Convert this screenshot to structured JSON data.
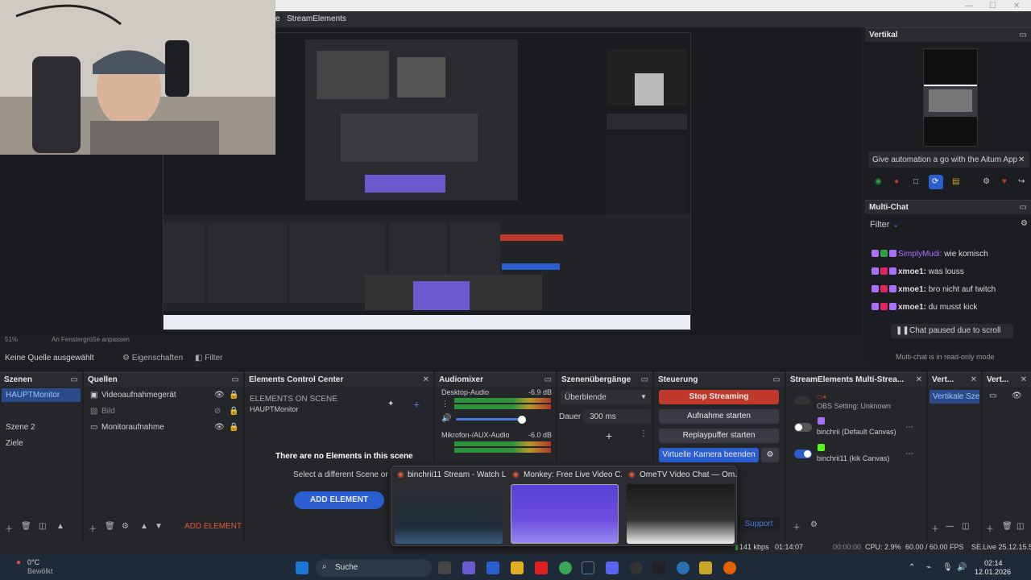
{
  "menu": {
    "item1": "e",
    "item2": "StreamElements"
  },
  "status_left": "Keine Quelle ausgewählt",
  "toolbar": {
    "properties": "Eigenschaften",
    "filter": "Filter"
  },
  "preview_zoom": {
    "value": "51%",
    "label": "An Fenstergröße anpassen"
  },
  "docks": {
    "scenes": {
      "title": "Szenen",
      "items": [
        "HAUPTMonitor",
        "Szene 2",
        "Ziele"
      ]
    },
    "sources": {
      "title": "Quellen",
      "items": [
        "Videoaufnahmegerät",
        "Bild",
        "Monitoraufnahme"
      ]
    },
    "ecc": {
      "title": "Elements Control Center",
      "heading": "ELEMENTS ON SCENE",
      "scene": "HAUPTMonitor",
      "empty": "There are no Elements in this scene",
      "hint": "Select a different Scene or",
      "add": "ADD ELEMENT"
    },
    "audio": {
      "title": "Audiomixer",
      "ch1": "Desktop-Audio",
      "ch1_db": "-6.9 dB",
      "ch2": "Mikrofon-/AUX-Audio",
      "ch2_db": "-6.0 dB"
    },
    "transitions": {
      "title": "Szenenübergänge",
      "type": "Überblende",
      "duration_label": "Dauer",
      "duration": "300 ms"
    },
    "controls": {
      "title": "Steuerung",
      "stop": "Stop Streaming",
      "record": "Aufnahme starten",
      "replay": "Replaypuffer starten",
      "vcam": "Virtuelle Kamera beenden",
      "support": "Support"
    },
    "multistream": {
      "title": "StreamElements Multi-Strea...",
      "obs": "OBS Setting: Unknown",
      "ch1": "binchrii (Default Canvas)",
      "ch2": "binchrii11 (kik Canvas)"
    },
    "vert1": {
      "title": "Vert...",
      "btn": "Vertikale Szene"
    },
    "vert2": {
      "title": "Vert..."
    }
  },
  "ecc_bottom_add": "ADD ELEMENT",
  "right": {
    "vertical_title": "Vertikal",
    "promo": "Give automation a go with the Aitum App",
    "multichat_title": "Multi-Chat",
    "filter": "Filter",
    "chat": [
      {
        "user": "SimplyMudi:",
        "msg": "wie komisch",
        "color": "#a970ff"
      },
      {
        "user": "xmoe1:",
        "msg": "was louss",
        "color": "#ffffff"
      },
      {
        "user": "xmoe1:",
        "msg": "bro nicht auf twitch",
        "color": "#ffffff"
      },
      {
        "user": "xmoe1:",
        "msg": "du musst kick",
        "color": "#ffffff"
      }
    ],
    "paused": "Chat paused due to scroll",
    "readonly": "Multi-chat is in read-only mode"
  },
  "popup": {
    "tabs": [
      "binchrii11 Stream - Watch L...",
      "Monkey: Free Live Video C...",
      "OmeTV Video Chat — Om..."
    ]
  },
  "statusbar": {
    "kbps": "141 kbps",
    "time1": "01:14:07",
    "time2": "00:00:00",
    "cpu": "CPU: 2.9%",
    "fps": "60.00 / 60.00 FPS",
    "live": "SE.Live 25.12.15.53..."
  },
  "taskbar": {
    "weather_temp": "0°C",
    "weather_desc": "Bewölkt",
    "search": "Suche",
    "time": "02:14",
    "date": "12.01.2026"
  },
  "colors": {
    "accent_blue": "#2a5ed1",
    "stop_red": "#c0392b",
    "twitch_purple": "#a970ff",
    "kick_green": "#53fc18"
  }
}
